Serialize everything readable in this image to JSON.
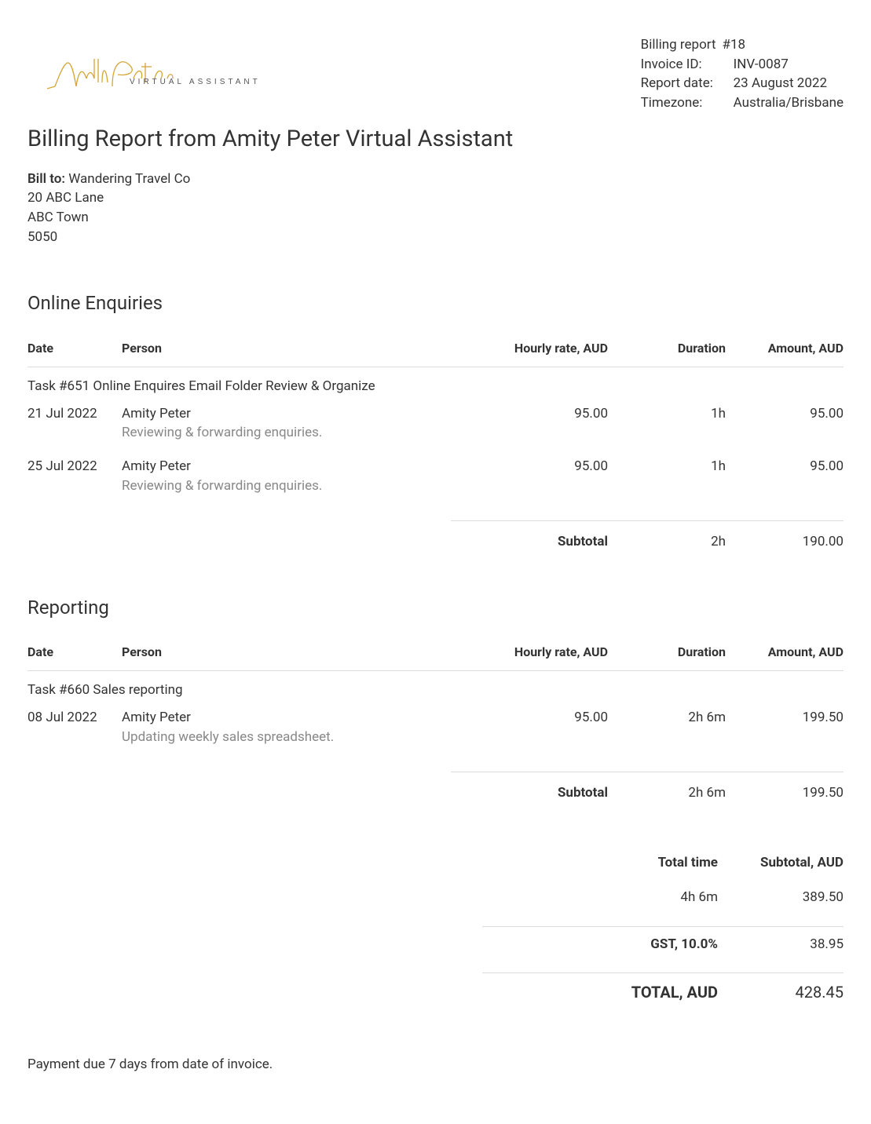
{
  "logo": {
    "brand_text": "Amity Peter",
    "sub_text": "VIRTUAL ASSISTANT"
  },
  "meta": {
    "report_label": "Billing report",
    "report_number": "#18",
    "invoice_id_label": "Invoice ID:",
    "invoice_id": "INV-0087",
    "report_date_label": "Report date:",
    "report_date": "23 August 2022",
    "timezone_label": "Timezone:",
    "timezone": "Australia/Brisbane"
  },
  "title": "Billing Report from Amity Peter Virtual Assistant",
  "bill_to": {
    "label": "Bill to:",
    "name": "Wandering Travel Co",
    "line1": "20 ABC Lane",
    "line2": "ABC Town",
    "line3": "5050"
  },
  "columns": {
    "date": "Date",
    "person": "Person",
    "rate": "Hourly rate, AUD",
    "duration": "Duration",
    "amount": "Amount, AUD"
  },
  "subtotal_label": "Subtotal",
  "sections": [
    {
      "title": "Online Enquiries",
      "task_label": "Task #651 Online Enquires Email Folder Review & Organize",
      "entries": [
        {
          "date": "21 Jul 2022",
          "person": "Amity Peter",
          "note": "Reviewing & forwarding enquiries.",
          "rate": "95.00",
          "duration": "1h",
          "amount": "95.00"
        },
        {
          "date": "25 Jul 2022",
          "person": "Amity Peter",
          "note": "Reviewing & forwarding enquiries.",
          "rate": "95.00",
          "duration": "1h",
          "amount": "95.00"
        }
      ],
      "subtotal_duration": "2h",
      "subtotal_amount": "190.00"
    },
    {
      "title": "Reporting",
      "task_label": "Task #660 Sales reporting",
      "entries": [
        {
          "date": "08 Jul 2022",
          "person": "Amity Peter",
          "note": "Updating weekly sales spreadsheet.",
          "rate": "95.00",
          "duration": "2h 6m",
          "amount": "199.50"
        }
      ],
      "subtotal_duration": "2h 6m",
      "subtotal_amount": "199.50"
    }
  ],
  "totals": {
    "total_time_label": "Total time",
    "subtotal_label": "Subtotal, AUD",
    "total_time": "4h 6m",
    "subtotal": "389.50",
    "gst_label": "GST, 10.0%",
    "gst": "38.95",
    "grand_label": "TOTAL, AUD",
    "grand": "428.45"
  },
  "footer_note": "Payment due 7 days from date of invoice."
}
